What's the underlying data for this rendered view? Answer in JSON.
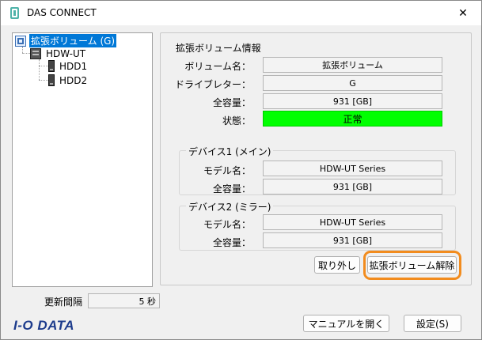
{
  "window": {
    "title": "DAS CONNECT",
    "close_symbol": "✕"
  },
  "tree": {
    "root": "拡張ボリューム (G)",
    "device": "HDW-UT",
    "disks": [
      "HDD1",
      "HDD2"
    ]
  },
  "volume_info": {
    "title": "拡張ボリューム情報",
    "volume_name_label": "ボリューム名：",
    "volume_name": "拡張ボリューム",
    "drive_letter_label": "ドライブレター：",
    "drive_letter": "G",
    "capacity_label": "全容量：",
    "capacity": "931 [GB]",
    "status_label": "状態：",
    "status": "正常",
    "status_color": "#00ff00"
  },
  "device1": {
    "title": "デバイス1 (メイン)",
    "model_label": "モデル名：",
    "model": "HDW-UT Series",
    "capacity_label": "全容量：",
    "capacity": "931 [GB]"
  },
  "device2": {
    "title": "デバイス2 (ミラー)",
    "model_label": "モデル名：",
    "model": "HDW-UT Series",
    "capacity_label": "全容量：",
    "capacity": "931 [GB]"
  },
  "buttons": {
    "remove": "取り外し",
    "release_volume": "拡張ボリューム解除",
    "open_manual": "マニュアルを開く",
    "settings": "設定(S)"
  },
  "footer": {
    "interval_label": "更新間隔",
    "interval_value": "5 秒",
    "logo": "I-O DATA"
  },
  "colors": {
    "accent": "#0078d7",
    "highlight": "#f28c1e",
    "logo": "#1c3b8c"
  }
}
